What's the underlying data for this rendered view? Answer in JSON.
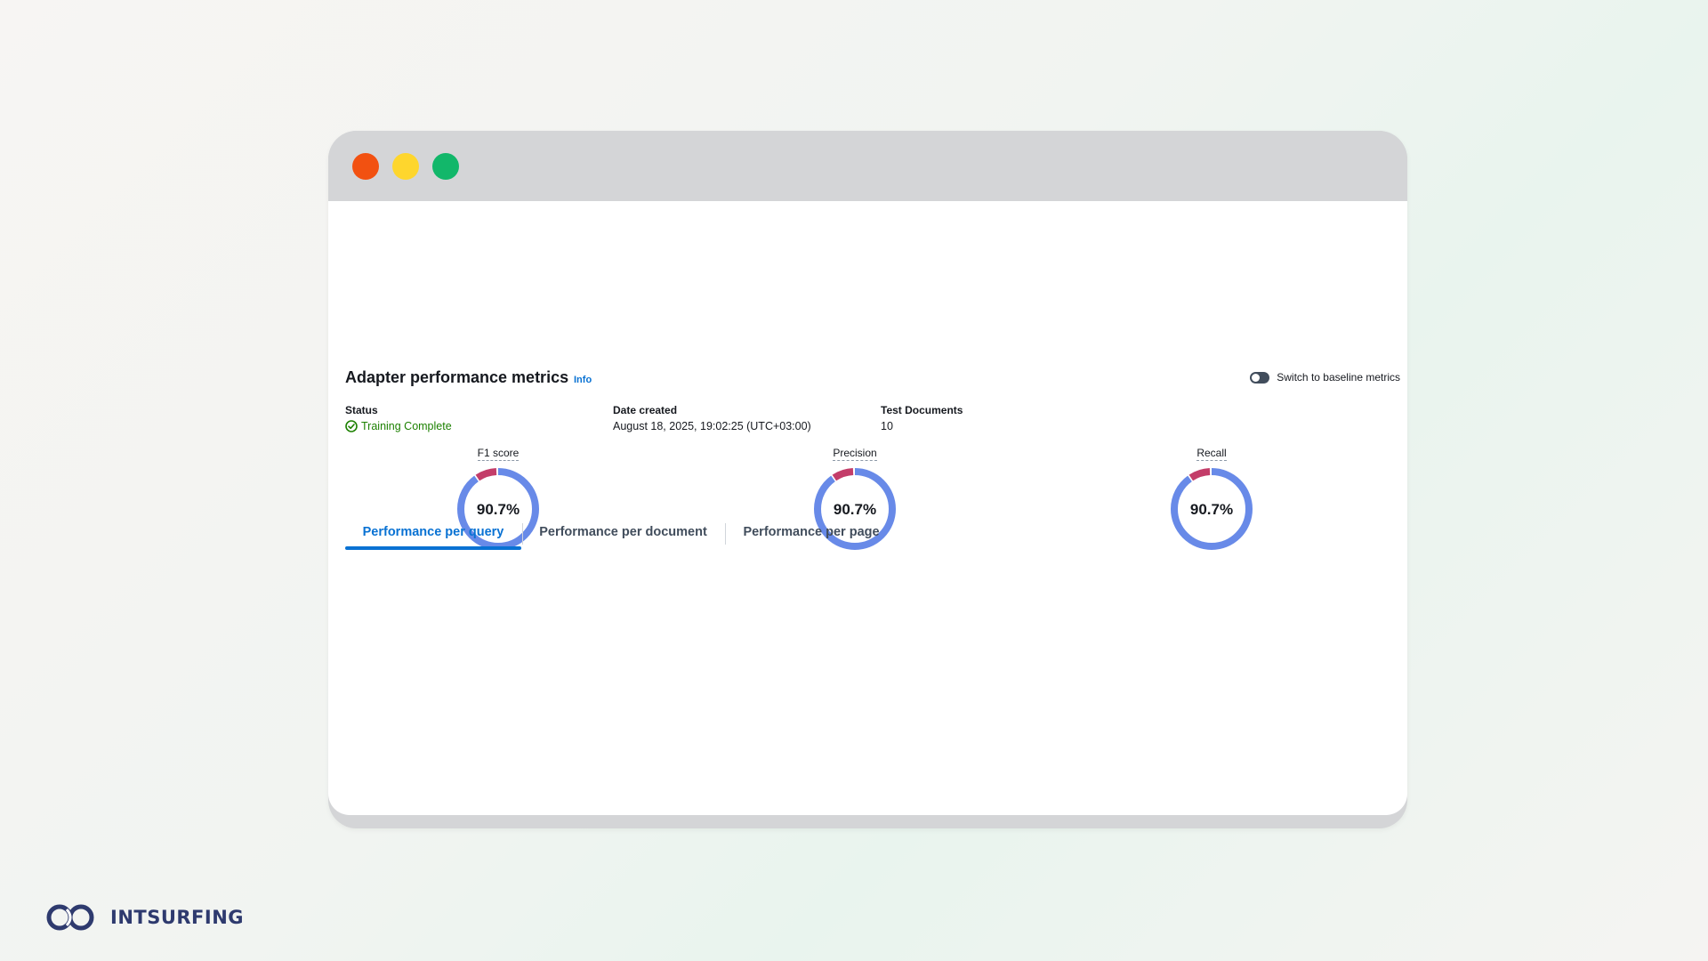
{
  "window": {
    "controls": [
      "close",
      "minimize",
      "maximize"
    ],
    "colors": {
      "close": "#f25111",
      "minimize": "#fed62d",
      "maximize": "#12b76a"
    }
  },
  "header": {
    "title": "Adapter performance metrics",
    "info_link": "Info",
    "toggle": {
      "label": "Switch to baseline metrics",
      "on": false
    }
  },
  "details": {
    "status": {
      "label": "Status",
      "value": "Training Complete",
      "icon": "check-circle-icon",
      "color": "#1d8102"
    },
    "date_created": {
      "label": "Date created",
      "value": "August 18, 2025, 19:02:25 (UTC+03:00)"
    },
    "test_documents": {
      "label": "Test Documents",
      "value": "10"
    }
  },
  "metrics": [
    {
      "label": "F1 score",
      "value": "90.7%",
      "fraction": 0.907
    },
    {
      "label": "Precision",
      "value": "90.7%",
      "fraction": 0.907
    },
    {
      "label": "Recall",
      "value": "90.7%",
      "fraction": 0.907
    }
  ],
  "metric_colors": {
    "value": "#688ae8",
    "remainder": "#c33d69"
  },
  "tabs": [
    {
      "label": "Performance per query",
      "active": true
    },
    {
      "label": "Performance per document",
      "active": false
    },
    {
      "label": "Performance per page",
      "active": false
    }
  ],
  "brand": {
    "name": "INTSURFING",
    "icon": "infinity-loop-logo",
    "color": "#2e3a6e"
  }
}
